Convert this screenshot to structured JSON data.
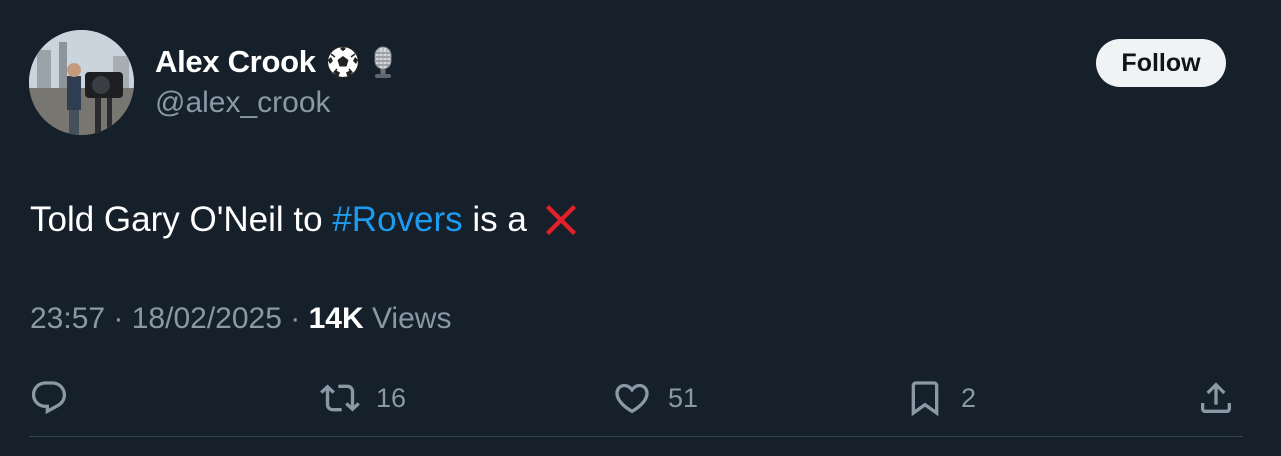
{
  "author": {
    "display_name": "Alex Crook",
    "handle": "@alex_crook",
    "badges": [
      "soccer-ball-emoji",
      "microphone-emoji"
    ]
  },
  "follow_label": "Follow",
  "tweet": {
    "text_before": "Told Gary O'Neil to ",
    "hashtag": "#Rovers",
    "text_after": " is a",
    "trailing_emoji": "red-cross-mark-emoji"
  },
  "meta": {
    "time": "23:57",
    "separator": " · ",
    "date": "18/02/2025",
    "views_count": "14K",
    "views_label": " Views"
  },
  "actions": {
    "retweets": "16",
    "likes": "51",
    "bookmarks": "2"
  },
  "colors": {
    "background": "#15202b",
    "hashtag": "#1d9bf0",
    "secondary_text": "#8b98a5",
    "cross": "#e5202b"
  }
}
